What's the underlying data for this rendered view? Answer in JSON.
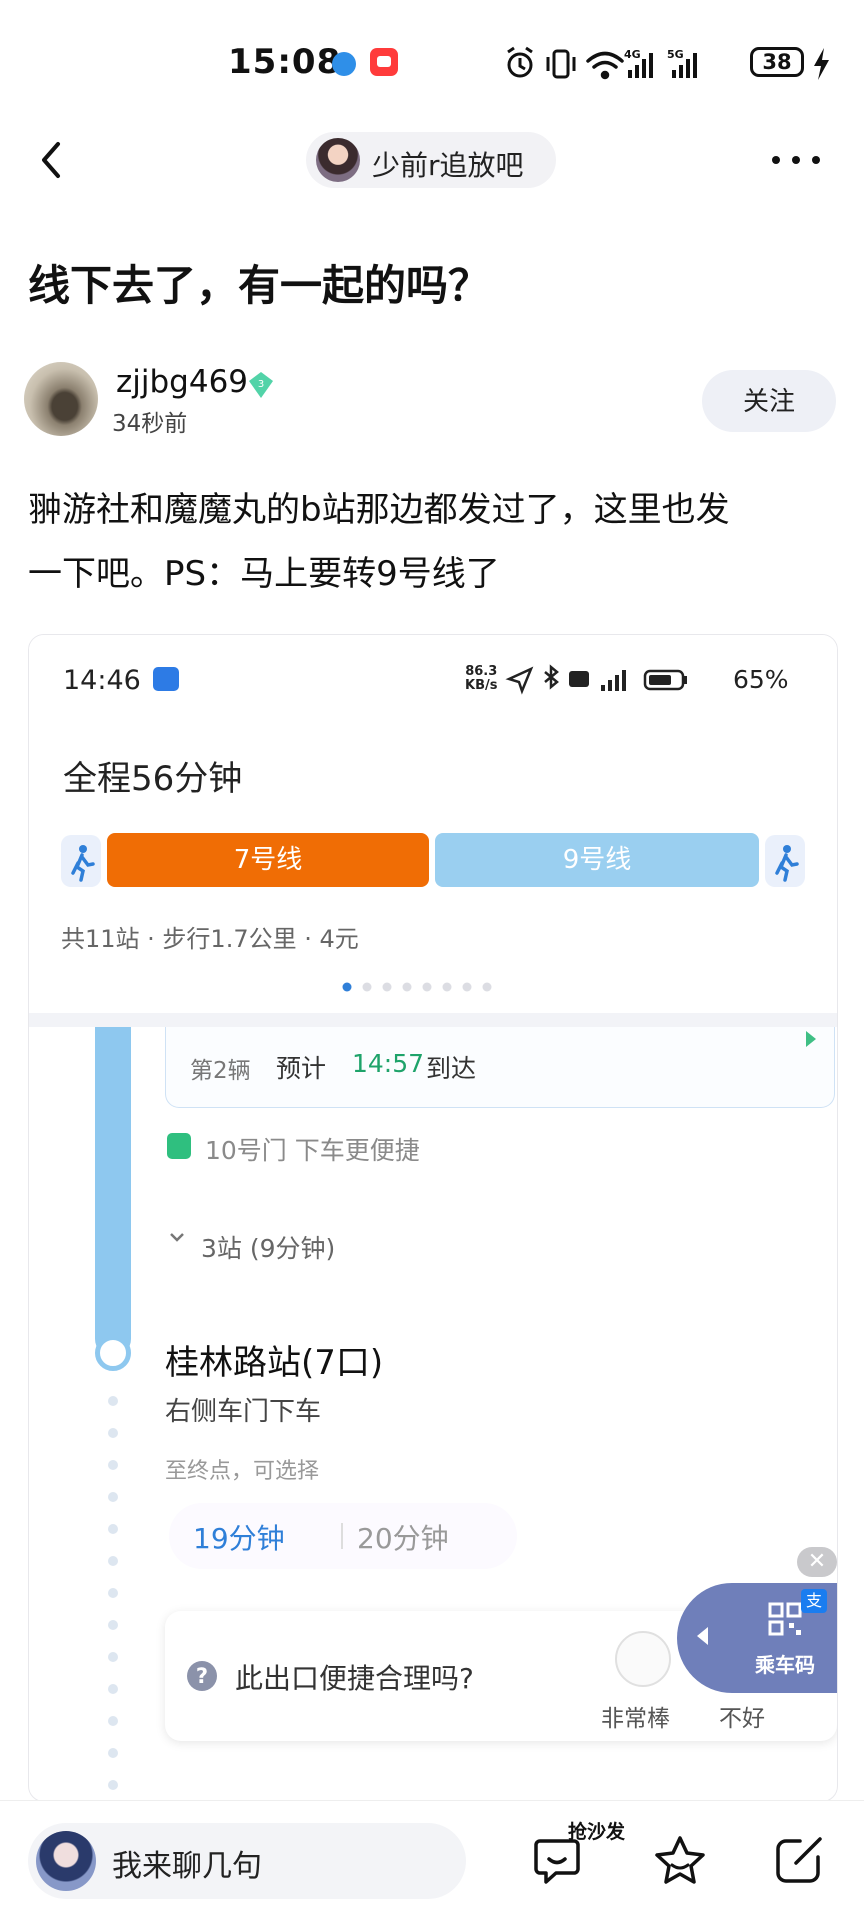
{
  "status_bar": {
    "time": "15:08",
    "battery": "38",
    "icons": [
      "alarm-icon",
      "vibrate-icon",
      "wifi-icon",
      "4g-signal-icon",
      "5g-signal-icon",
      "battery-icon",
      "charging-icon"
    ]
  },
  "nav": {
    "forum_name": "少前r追放吧"
  },
  "post": {
    "title": "线下去了，有一起的吗？",
    "author": "zjjbg469",
    "level": "3",
    "time": "34秒前",
    "follow_label": "关注",
    "body_line1": "翀游社和魔魔丸的b站那边都发过了，这里也发",
    "body_line2": "一下吧。PS：马上要转9号线了"
  },
  "screenshot": {
    "clock": "14:46",
    "net_speed_value": "86.3",
    "net_speed_unit": "KB/s",
    "battery_pct": "65%",
    "total_time": "全程56分钟",
    "line_a": "7号线",
    "line_b": "9号线",
    "route_meta": "共11站 · 步行1.7公里 · 4元",
    "page_count": 8,
    "page_active": 1,
    "car_no": "第2辆",
    "est_label": "预计",
    "est_time": "14:57",
    "arrive_label": "到达",
    "door_tip": "10号门 下车更便捷",
    "stops": "3站 (9分钟)",
    "station": "桂林路站(7口)",
    "station_hint": "右侧车门下车",
    "terminal_hint": "至终点，可选择",
    "walk_mode": "19分钟",
    "bus_mode": "20分钟",
    "feedback_q": "此出口便捷合理吗?",
    "feedback_good": "非常棒",
    "feedback_bad": "不好",
    "ride_code": "乘车码",
    "alipay_badge": "支",
    "close_icon": "✕",
    "question_mark": "?"
  },
  "bottom": {
    "comment_placeholder": "我来聊几句",
    "sofa_label": "抢沙发"
  },
  "colors": {
    "line7": "#f06d05",
    "line9": "#9acff0",
    "accent_green": "#1ea36a",
    "walk_blue": "#2f7fd8"
  }
}
